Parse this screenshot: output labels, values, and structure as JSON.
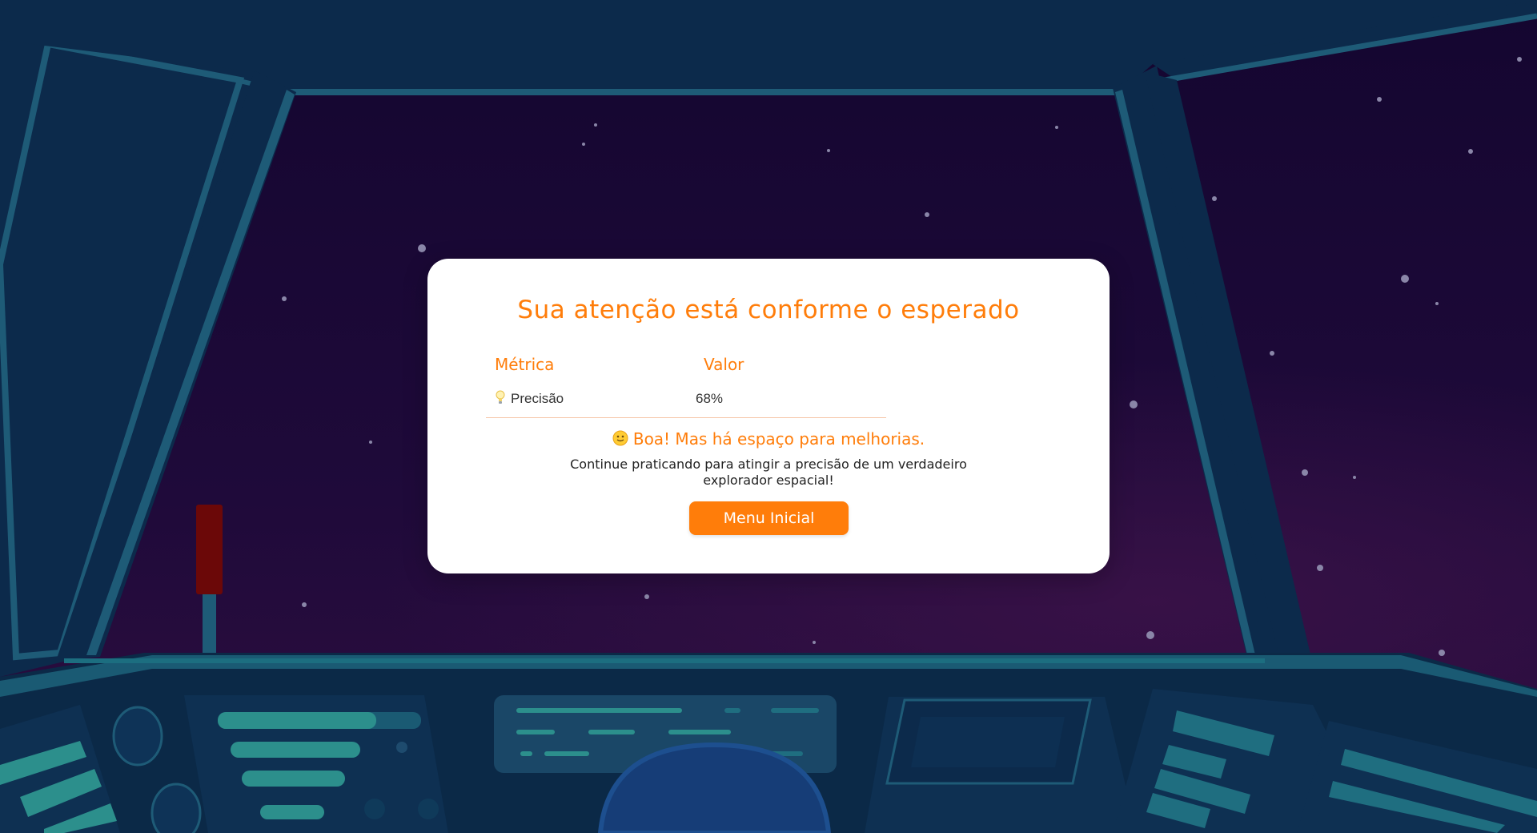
{
  "scene": {
    "description_icon": "spaceship-cockpit",
    "colors": {
      "space_top": "#170731",
      "space_bottom": "#2a0c3e",
      "frame": "#0c2a4b",
      "frame_edge": "#1e5b77",
      "console": "#0b2947",
      "accent_teal": "#2c8f8c",
      "lever_red": "#6b0808"
    }
  },
  "result": {
    "title": "Sua atenção está conforme o esperado",
    "table": {
      "headers": [
        "Métrica",
        "Valor"
      ],
      "rows": [
        {
          "icon": "lightbulb-icon",
          "metric": "Precisão",
          "value": "68%"
        }
      ]
    },
    "feedback": {
      "icon": "smile-icon",
      "title": "Boa! Mas há espaço para melhorias.",
      "description": "Continue praticando para atingir a precisão de um verdadeiro explorador espacial!"
    },
    "button_label": "Menu Inicial"
  },
  "colors": {
    "accent": "#ff7d0a",
    "card_bg": "#ffffff",
    "text": "#333333"
  }
}
